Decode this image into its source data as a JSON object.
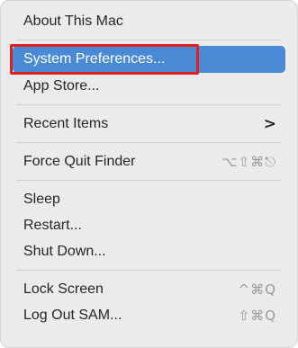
{
  "menu": {
    "about": "About This Mac",
    "system_prefs": "System Preferences...",
    "app_store": "App Store...",
    "recent_items": "Recent Items",
    "recent_items_chevron": ">",
    "force_quit": "Force Quit Finder",
    "force_quit_shortcut": "⌥⇧⌘⎋",
    "sleep": "Sleep",
    "restart": "Restart...",
    "shut_down": "Shut Down...",
    "lock_screen": "Lock Screen",
    "lock_screen_shortcut": "^⌘Q",
    "log_out": "Log Out SAM...",
    "log_out_shortcut": "⇧⌘Q"
  },
  "colors": {
    "selection": "#4a89d4",
    "annotation_box": "#e02020",
    "menu_background": "#ebebeb"
  }
}
